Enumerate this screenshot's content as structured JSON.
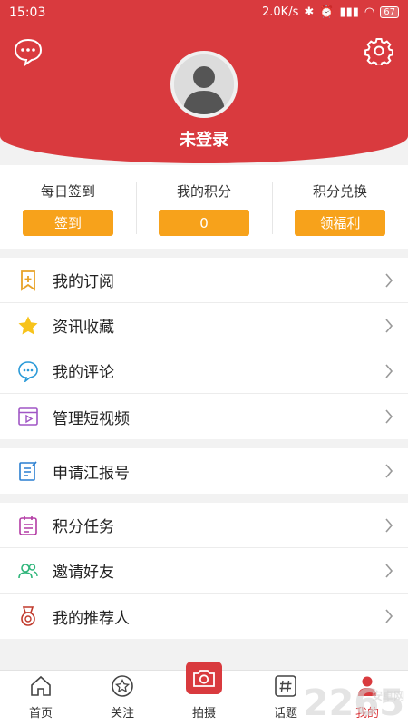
{
  "status_bar": {
    "time": "15:03",
    "speed": "2.0K/s",
    "battery": "67"
  },
  "profile": {
    "login_text": "未登录"
  },
  "stats": [
    {
      "label": "每日签到",
      "button": "签到"
    },
    {
      "label": "我的积分",
      "button": "0"
    },
    {
      "label": "积分兑换",
      "button": "领福利"
    }
  ],
  "menu_group_1": [
    {
      "label": "我的订阅",
      "icon": "bookmark-add-icon"
    },
    {
      "label": "资讯收藏",
      "icon": "star-icon"
    },
    {
      "label": "我的评论",
      "icon": "comment-icon"
    },
    {
      "label": "管理短视频",
      "icon": "video-icon"
    }
  ],
  "menu_group_2": [
    {
      "label": "申请江报号",
      "icon": "edit-document-icon"
    }
  ],
  "menu_group_3": [
    {
      "label": "积分任务",
      "icon": "calendar-task-icon"
    },
    {
      "label": "邀请好友",
      "icon": "invite-friends-icon"
    },
    {
      "label": "我的推荐人",
      "icon": "medal-icon"
    }
  ],
  "nav": [
    {
      "label": "首页",
      "icon": "home-icon"
    },
    {
      "label": "关注",
      "icon": "follow-star-icon"
    },
    {
      "label": "拍摄",
      "icon": "camera-icon"
    },
    {
      "label": "话题",
      "icon": "hashtag-icon"
    },
    {
      "label": "我的",
      "icon": "profile-icon"
    }
  ],
  "watermark": {
    "main": "2265",
    "sub": "安卓网"
  },
  "colors": {
    "brand_red": "#d93a3e",
    "button_orange": "#f7a21b"
  }
}
